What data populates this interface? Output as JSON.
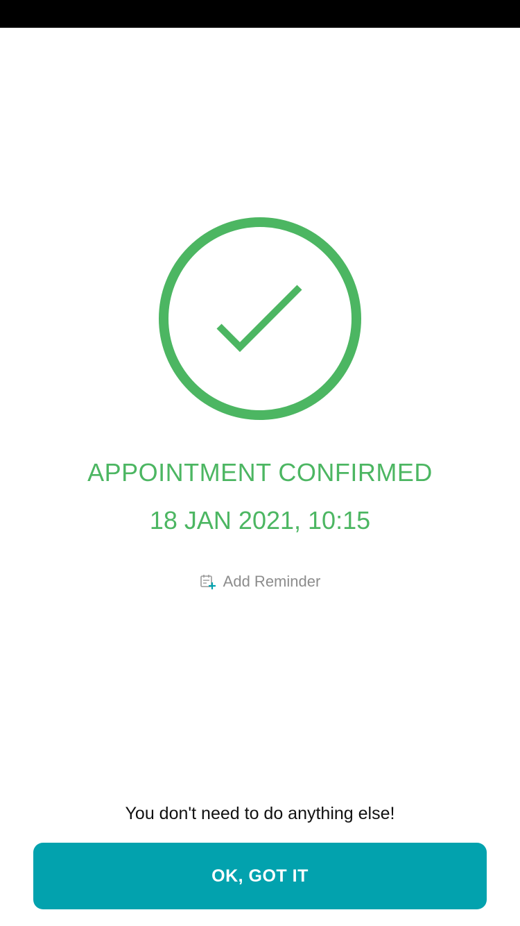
{
  "confirmation": {
    "title": "APPOINTMENT CONFIRMED",
    "datetime": "18 JAN 2021, 10:15",
    "icon": "check-circle-icon",
    "accent_color": "#4cb662"
  },
  "reminder": {
    "label": "Add Reminder",
    "icon": "calendar-add-icon"
  },
  "footer": {
    "info_text": "You don't need to do anything else!",
    "button_label": "OK, GOT IT",
    "button_color": "#02a2ae"
  }
}
